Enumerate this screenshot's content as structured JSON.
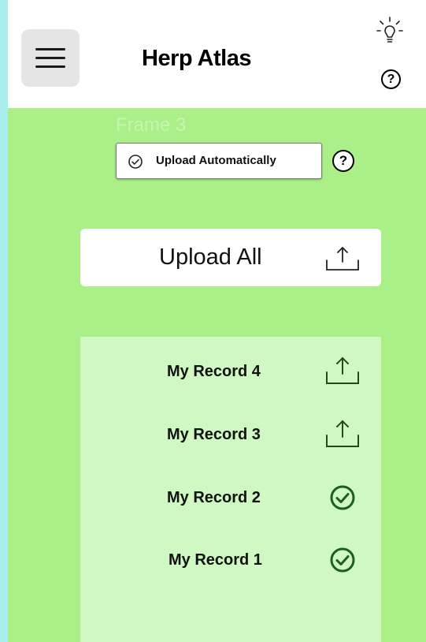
{
  "app": {
    "title": "Herp Atlas",
    "frame_label": "Frame 3"
  },
  "header": {
    "menu_icon": "hamburger-icon",
    "theme_icon": "lightbulb-icon",
    "help_label": "?"
  },
  "auto_upload": {
    "label": "Upload Automatically",
    "checked": true,
    "help_label": "?"
  },
  "upload_all": {
    "label": "Upload All",
    "icon": "upload-icon"
  },
  "records": [
    {
      "label": "My Record 4",
      "status": "pending",
      "icon": "upload-icon"
    },
    {
      "label": "My Record 3",
      "status": "pending",
      "icon": "upload-icon"
    },
    {
      "label": "My Record 2",
      "status": "uploaded",
      "icon": "check-circle-icon"
    },
    {
      "label": "My Record 1",
      "status": "uploaded",
      "icon": "check-circle-icon"
    }
  ],
  "colors": {
    "background": "#abef88",
    "list_background": "#d0f8c2",
    "check": "#1d5c26"
  }
}
